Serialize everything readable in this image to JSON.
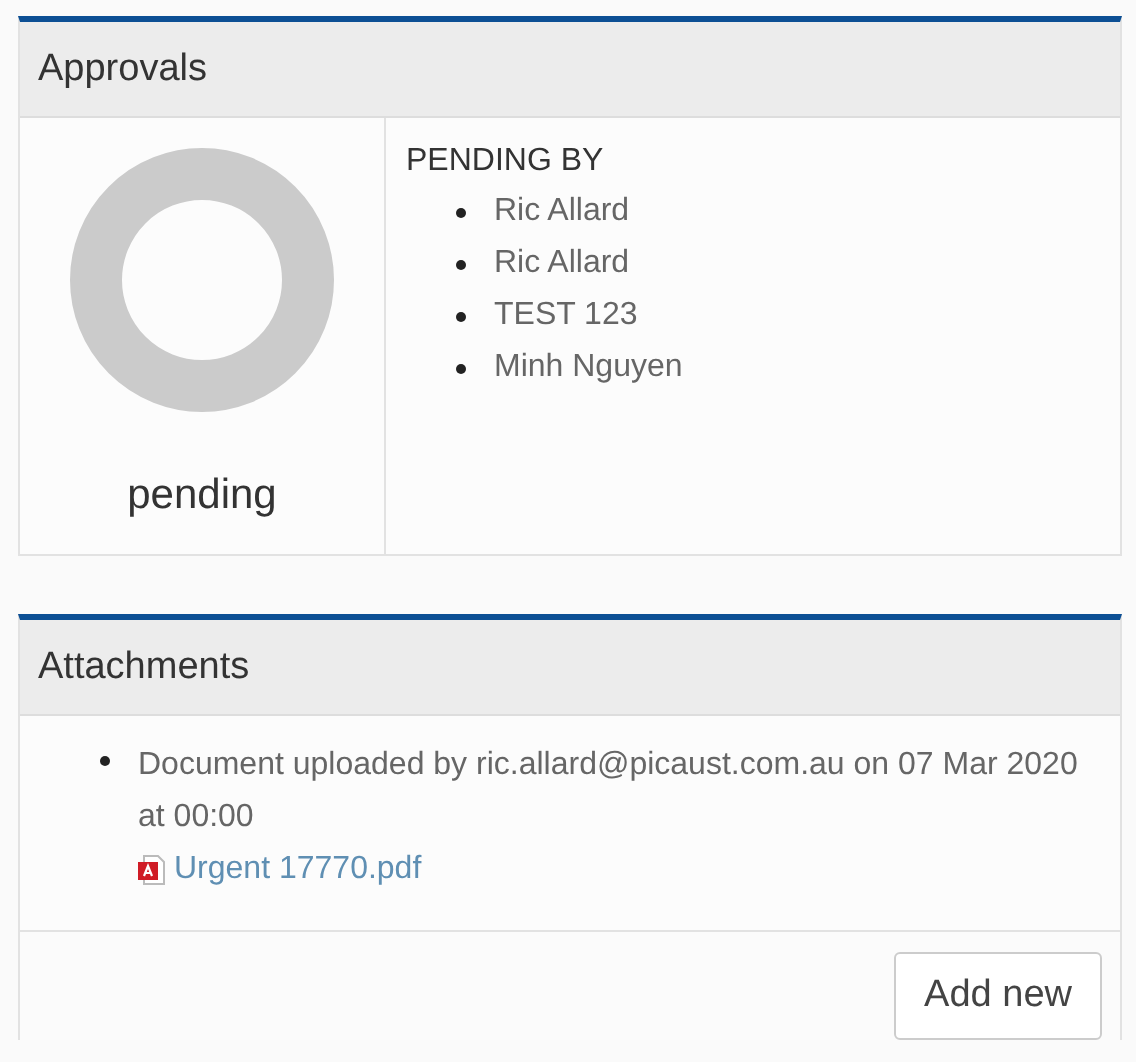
{
  "approvals": {
    "title": "Approvals",
    "status": "pending",
    "pending_by": {
      "heading": "PENDING BY",
      "names": [
        "Ric Allard",
        "Ric Allard",
        "TEST 123",
        "Minh Nguyen"
      ]
    }
  },
  "attachments": {
    "title": "Attachments",
    "items": [
      {
        "text": "Document uploaded by ric.allard@picaust.com.au on 07 Mar 2020 at 00:00",
        "file": "Urgent 17770.pdf"
      }
    ],
    "button": "Add new"
  }
}
